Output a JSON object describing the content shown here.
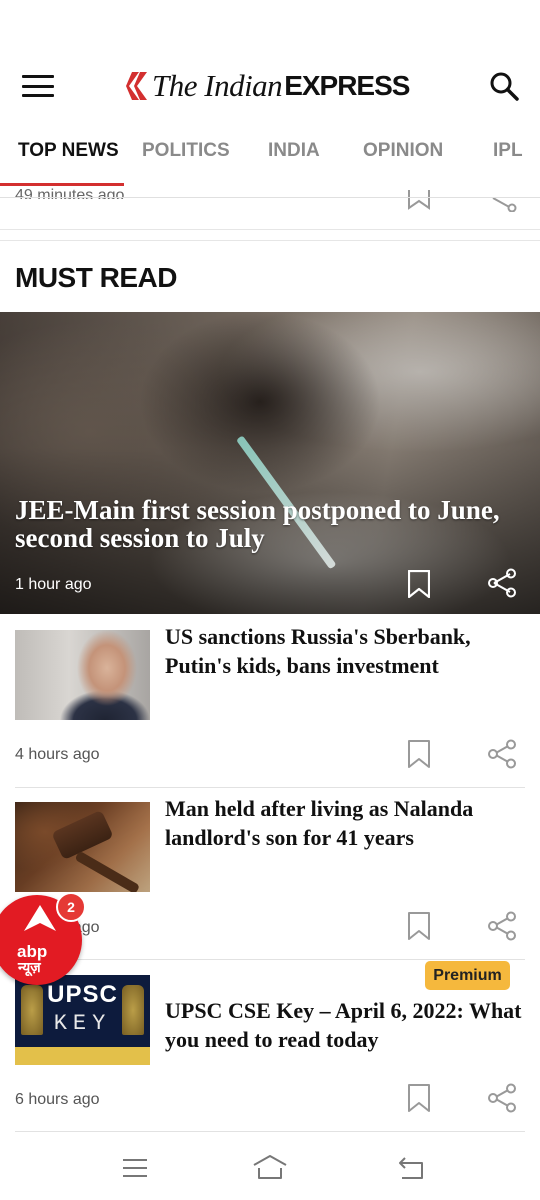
{
  "header": {
    "logo_the": "The Indian",
    "logo_express": "EXPRESS",
    "menu_icon": "hamburger-icon",
    "search_icon": "search-icon",
    "brand_color": "#d32f2f"
  },
  "tabs": [
    {
      "label": "TOP NEWS",
      "active": true
    },
    {
      "label": "POLITICS",
      "active": false
    },
    {
      "label": "INDIA",
      "active": false
    },
    {
      "label": "OPINION",
      "active": false
    },
    {
      "label": "IPL",
      "active": false
    }
  ],
  "previous_item": {
    "time": "49 minutes ago"
  },
  "section": {
    "title": "MUST READ"
  },
  "hero": {
    "title": "JEE-Main first session postponed to June, second session to July",
    "time": "1 hour ago"
  },
  "articles": [
    {
      "title": "US sanctions Russia's Sberbank, Putin's kids, bans investment",
      "time": "4 hours ago",
      "premium": false
    },
    {
      "title": "Man held after living as Nalanda landlord's son for 41 years",
      "time": "5 hours ago",
      "premium": false
    },
    {
      "title": "UPSC CSE Key – April 6, 2022: What you need to read today",
      "time": "6 hours ago",
      "premium": true
    }
  ],
  "premium_label": "Premium",
  "upsc_thumb": {
    "line1": "UPSC",
    "line2": "KEY"
  },
  "floating_app": {
    "name_latin": "abp",
    "name_hindi": "न्यूज़",
    "badge_count": "2",
    "color": "#e21b23"
  },
  "navbar": {
    "icons": [
      "menu-icon",
      "home-icon",
      "back-icon"
    ]
  }
}
